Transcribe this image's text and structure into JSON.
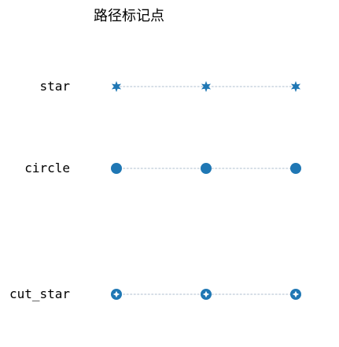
{
  "chart_data": {
    "type": "scatter",
    "title": "路径标记点",
    "xlabel": "",
    "ylabel": "",
    "axes_visible": false,
    "grid": false,
    "marker_color": "#1f77b4",
    "line_color": "#c8d3de",
    "line_style": "dotted",
    "x": [
      0,
      1,
      2
    ],
    "rows": [
      {
        "label": "star",
        "marker": "star-icon"
      },
      {
        "label": "circle",
        "marker": "circle-icon"
      },
      {
        "label": "cut_star",
        "marker": "cut-star-icon"
      }
    ]
  }
}
